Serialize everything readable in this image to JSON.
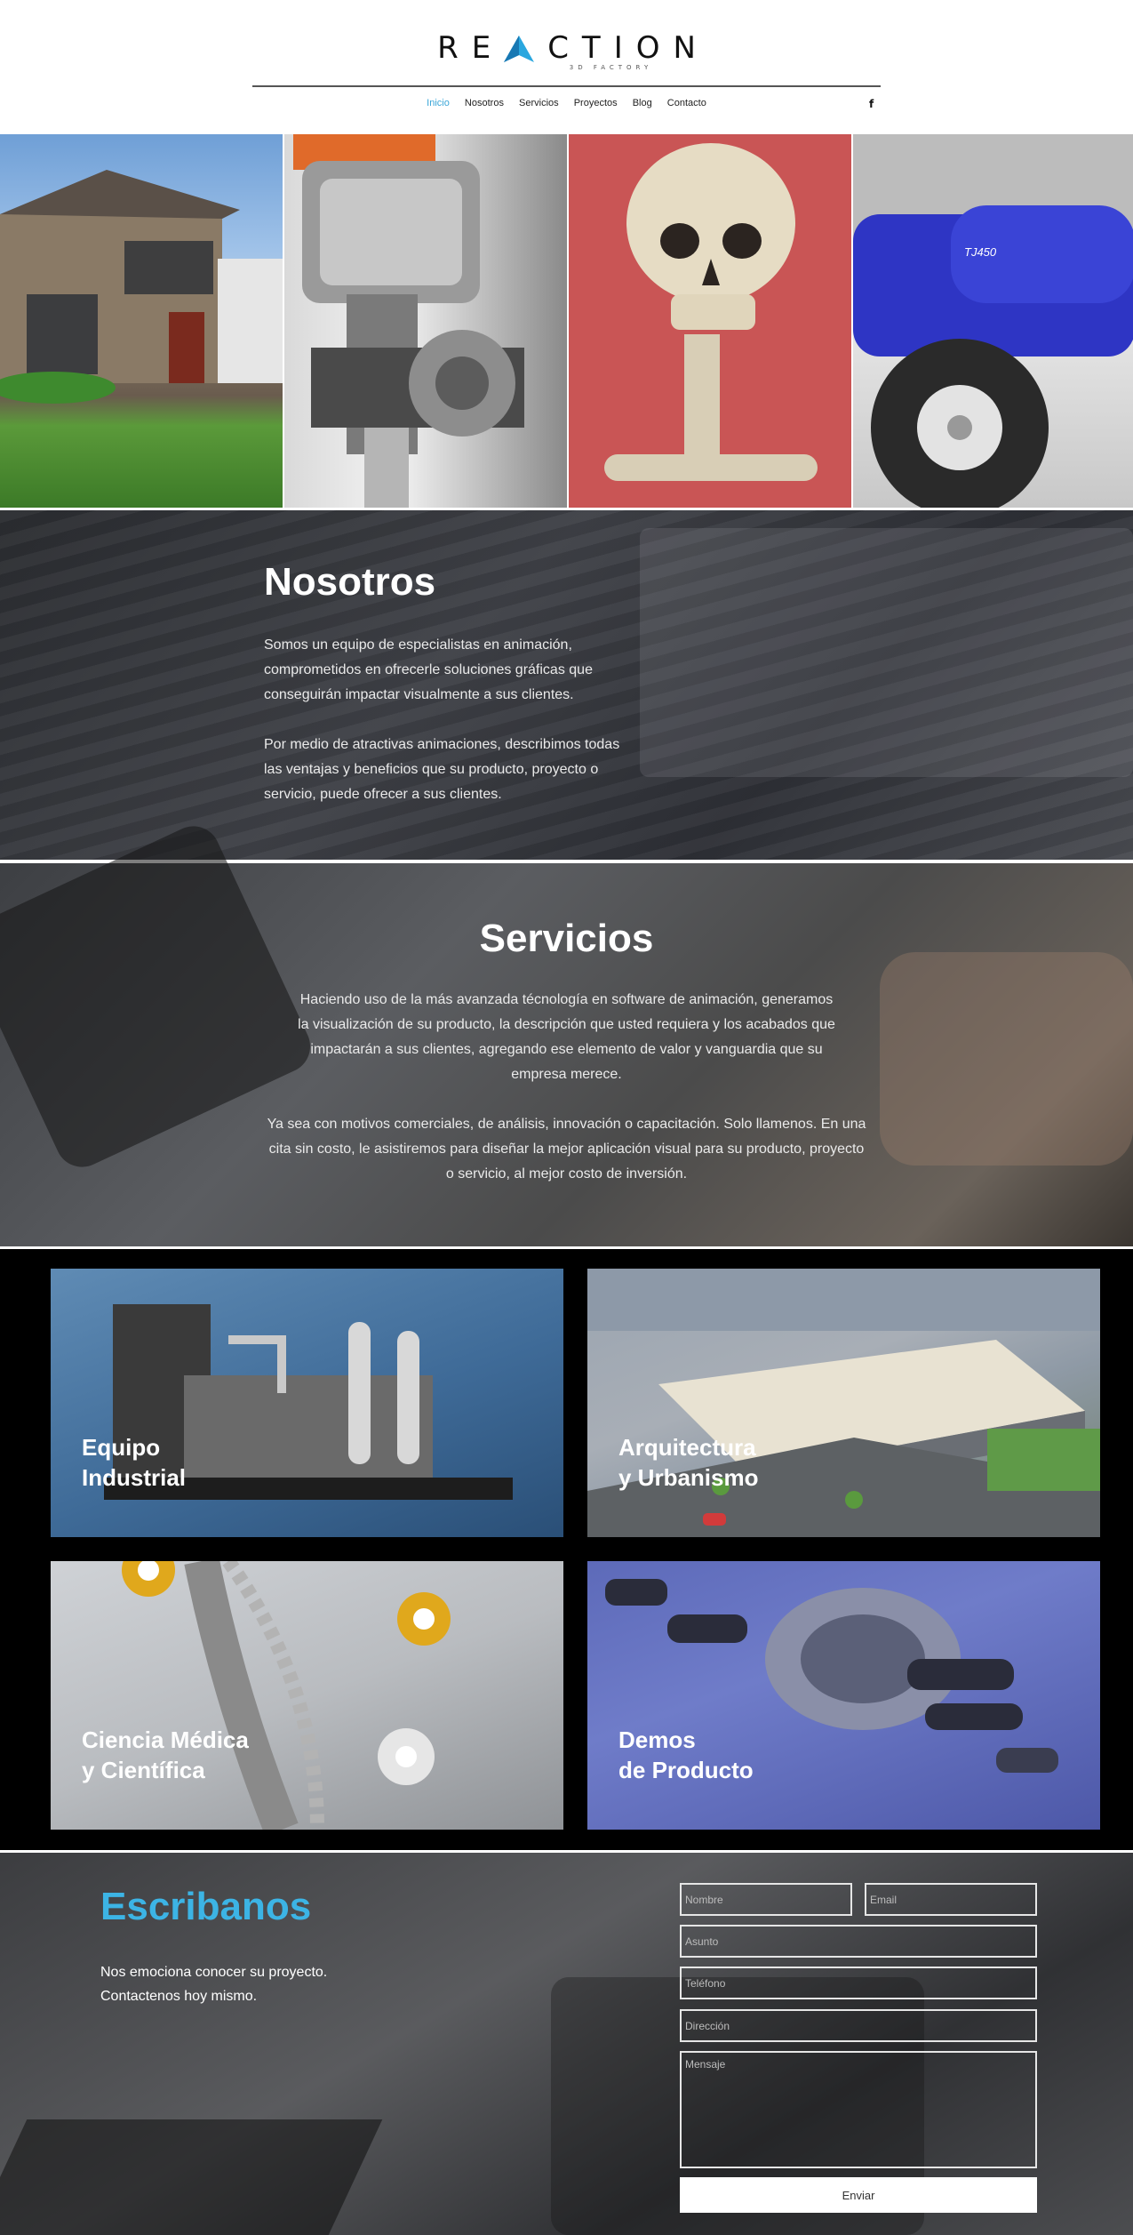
{
  "brand": {
    "name_left": "RE",
    "name_right": "CTION",
    "tagline": "3D FACTORY"
  },
  "nav": {
    "items": [
      "Inicio",
      "Nosotros",
      "Servicios",
      "Proyectos",
      "Blog",
      "Contacto"
    ],
    "active": "Inicio",
    "social_icon": "facebook-icon",
    "social_glyph": "f"
  },
  "hero": {
    "panels": [
      "house-render",
      "gear-mechanism",
      "skull-skeleton",
      "blue-tractor"
    ],
    "tractor_badge": "TJ450"
  },
  "nosotros": {
    "title": "Nosotros",
    "paragraph1": "Somos un equipo de especialistas en animación, comprometidos en ofrecerle soluciones gráficas que conseguirán impactar visualmente a sus clientes.",
    "paragraph2": "Por medio de atractivas animaciones, describimos todas las ventajas y beneficios que su producto, proyecto o servicio, puede ofrecer a sus clientes."
  },
  "servicios": {
    "title": "Servicios",
    "paragraph1": "Haciendo uso de la más avanzada técnología en software de animación, generamos la visualización de su producto, la descripción que usted requiera y los acabados que impactarán a sus clientes, agregando ese elemento de valor y vanguardia que su empresa merece.",
    "paragraph2": "Ya sea con motivos comerciales, de análisis, innovación o capacitación. Solo llamenos. En una cita sin costo, le asistiremos para diseñar la mejor aplicación visual para su producto, proyecto o servicio, al mejor costo de inversión."
  },
  "services_grid": {
    "tiles": [
      {
        "line1": "Equipo",
        "line2": "Industrial"
      },
      {
        "line1": "Arquitectura",
        "line2": "y Urbanismo"
      },
      {
        "line1": "Ciencia Médica",
        "line2": "y Científica"
      },
      {
        "line1": "Demos",
        "line2": "de Producto"
      }
    ]
  },
  "contact": {
    "title": "Escribanos",
    "subtitle_line1": "Nos emociona conocer su proyecto.",
    "subtitle_line2": "Contactenos hoy mismo.",
    "placeholders": {
      "name": "Nombre",
      "email": "Email",
      "subject": "Asunto",
      "phone": "Teléfono",
      "address": "Dirección",
      "message": "Mensaje"
    },
    "submit_label": "Enviar"
  },
  "colors": {
    "accent": "#3cb4e5",
    "nav_active": "#3aa6d8"
  }
}
